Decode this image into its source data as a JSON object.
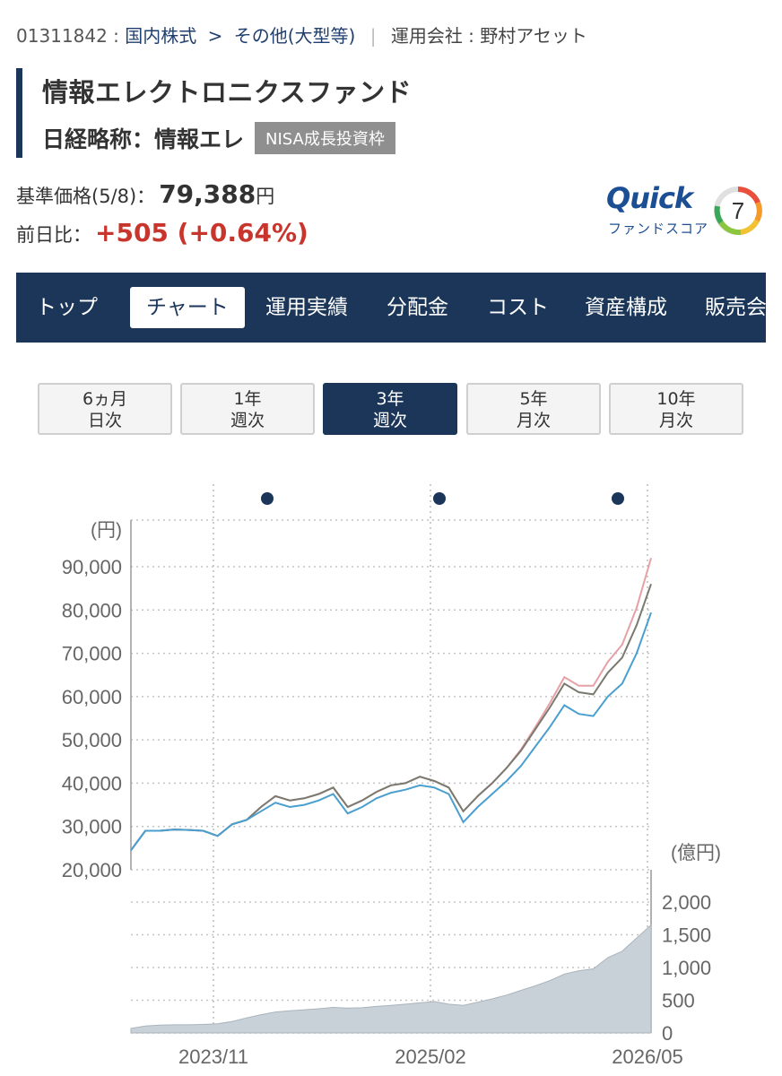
{
  "breadcrumb": {
    "code": "01311842 :",
    "category": "国内株式",
    "sep": ">",
    "subcategory": "その他(大型等)",
    "bar": "|",
    "company_label": "運用会社 : 野村アセット"
  },
  "fund": {
    "name": "情報エレクトロニクスファンド",
    "nikkei_label": "日経略称：情報エレ",
    "badge": "NISA成長投資枠"
  },
  "price": {
    "label": "基準価格(5/8)：",
    "value": "79,388",
    "unit": "円",
    "change_label": "前日比：",
    "change_value": "+505 (+0.64%)"
  },
  "quick_score": {
    "brand": "Quick",
    "sub": "ファンドスコア",
    "score": "7"
  },
  "nav": [
    {
      "label": "トップ",
      "active": false
    },
    {
      "label": "チャート",
      "active": true
    },
    {
      "label": "運用実績",
      "active": false
    },
    {
      "label": "分配金",
      "active": false
    },
    {
      "label": "コスト",
      "active": false
    },
    {
      "label": "資産構成",
      "active": false
    },
    {
      "label": "販売会",
      "active": false
    }
  ],
  "periods": [
    {
      "line1": "6ヵ月",
      "line2": "日次",
      "active": false
    },
    {
      "line1": "1年",
      "line2": "週次",
      "active": false
    },
    {
      "line1": "3年",
      "line2": "週次",
      "active": true
    },
    {
      "line1": "5年",
      "line2": "月次",
      "active": false
    },
    {
      "line1": "10年",
      "line2": "月次",
      "active": false
    }
  ],
  "colors": {
    "navy": "#1b3658",
    "price_up": "#c8352c",
    "line_nav": "#4a9fcf",
    "line_adjusted": "#7a7a70",
    "line_dividend": "#e6a0a6",
    "area_fill": "#c9d1d8"
  },
  "chart_data": {
    "type": "line",
    "ylabel": "(円)",
    "y2label": "(億円)",
    "ylim": [
      20000,
      90000
    ],
    "y2lim": [
      0,
      2000
    ],
    "yticks": [
      "20,000",
      "30,000",
      "40,000",
      "50,000",
      "60,000",
      "70,000",
      "80,000",
      "90,000"
    ],
    "y2ticks": [
      "0",
      "500",
      "1,000",
      "1,500",
      "2,000"
    ],
    "xticks": [
      "2023/11",
      "2025/02",
      "2026/05"
    ],
    "x": [
      "2023/05",
      "2023/06",
      "2023/07",
      "2023/08",
      "2023/09",
      "2023/10",
      "2023/11",
      "2023/12",
      "2024/01",
      "2024/02",
      "2024/03",
      "2024/04",
      "2024/05",
      "2024/06",
      "2024/07",
      "2024/08",
      "2024/09",
      "2024/10",
      "2024/11",
      "2024/12",
      "2025/01",
      "2025/02",
      "2025/03",
      "2025/04",
      "2025/05",
      "2025/06",
      "2025/07",
      "2025/08",
      "2025/09",
      "2025/10",
      "2025/11",
      "2025/12",
      "2026/01",
      "2026/02",
      "2026/03",
      "2026/04",
      "2026/05"
    ],
    "series": [
      {
        "values": [
          24500,
          29000,
          29000,
          29300,
          29200,
          29000,
          27800,
          30500,
          31500,
          33500,
          35500,
          34500,
          35000,
          36000,
          37500,
          33000,
          34500,
          36500,
          37800,
          38500,
          39500,
          39000,
          37500,
          31000,
          34500,
          37500,
          40500,
          44000,
          48500,
          53000,
          58000,
          56000,
          55500,
          60000,
          63000,
          70000,
          79400
        ]
      },
      {
        "values": [
          24500,
          29000,
          29000,
          29300,
          29200,
          29000,
          27800,
          30500,
          31500,
          34500,
          37000,
          36000,
          36500,
          37500,
          39000,
          34500,
          36000,
          38000,
          39500,
          40000,
          41500,
          40500,
          39000,
          33500,
          37000,
          40000,
          43500,
          47500,
          52500,
          57500,
          63000,
          61000,
          60500,
          65500,
          69000,
          76500,
          86000
        ]
      },
      {
        "values": [
          24500,
          29000,
          29000,
          29300,
          29200,
          29000,
          27800,
          30500,
          31500,
          34500,
          37000,
          36000,
          36500,
          37500,
          39000,
          34500,
          36000,
          38000,
          39500,
          40000,
          41500,
          40500,
          39000,
          33500,
          37000,
          40000,
          43500,
          47800,
          53000,
          58500,
          64500,
          62500,
          62500,
          68000,
          72000,
          80500,
          92000
        ]
      }
    ],
    "net_assets": [
      70,
      105,
      120,
      125,
      125,
      130,
      140,
      175,
      230,
      280,
      320,
      340,
      355,
      370,
      390,
      380,
      385,
      405,
      420,
      440,
      460,
      480,
      440,
      420,
      470,
      520,
      580,
      650,
      720,
      800,
      900,
      950,
      980,
      1150,
      1250,
      1450,
      1650
    ],
    "markers": 3
  }
}
